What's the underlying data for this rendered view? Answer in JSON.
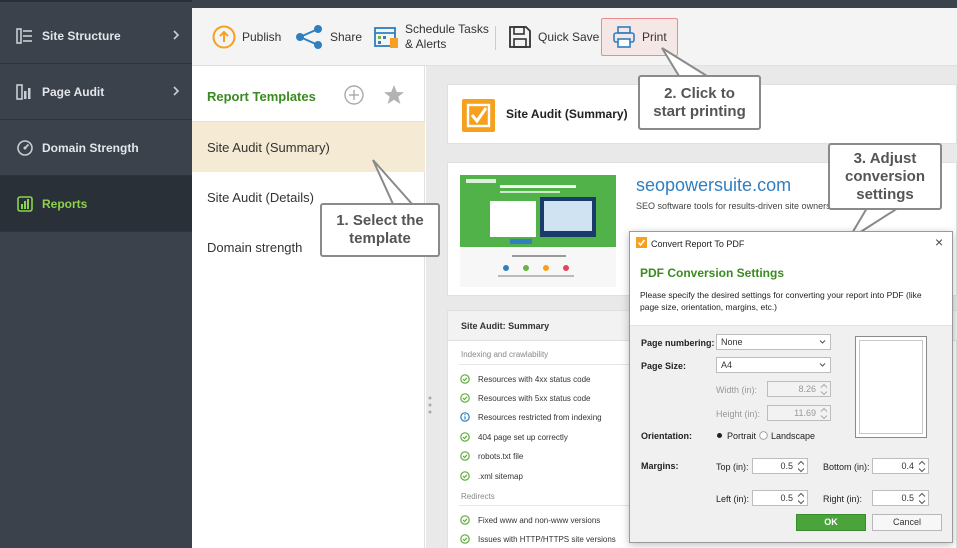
{
  "sidebar": {
    "items": [
      {
        "label": "Site Structure",
        "icon": "site-structure-icon"
      },
      {
        "label": "Page Audit",
        "icon": "page-audit-icon"
      },
      {
        "label": "Domain Strength",
        "icon": "domain-strength-icon"
      },
      {
        "label": "Reports",
        "icon": "reports-icon"
      }
    ],
    "active_color": "#8bd34a",
    "background": "#3b424b"
  },
  "toolbar": {
    "publish": "Publish",
    "share": "Share",
    "schedule_line1": "Schedule Tasks",
    "schedule_line2": "& Alerts",
    "quick_save": "Quick Save",
    "print": "Print"
  },
  "templates": {
    "title": "Report Templates",
    "items": [
      "Site Audit (Summary)",
      "Site Audit (Details)",
      "Domain strength"
    ]
  },
  "report": {
    "header_title": "Site Audit (Summary)",
    "site_url": "seopowersuite.com",
    "site_tagline": "SEO software tools for results-driven site owners",
    "summary_title": "Site Audit: Summary",
    "section_indexing": "Indexing and crawlability",
    "indexing_items": [
      "Resources with 4xx status code",
      "Resources with 5xx status code",
      "Resources restricted from indexing",
      "404 page set up correctly",
      "robots.txt file",
      ".xml sitemap"
    ],
    "section_redirects": "Redirects",
    "redirect_items": [
      "Fixed www and non-www versions",
      "Issues with HTTP/HTTPS site versions"
    ]
  },
  "callouts": {
    "select_line1": "1. Select the",
    "select_line2": "template",
    "print_line1": "2. Click to",
    "print_line2": "start printing",
    "adjust_line1": "3. Adjust",
    "adjust_line2": "conversion",
    "adjust_line3": "settings"
  },
  "dialog": {
    "window_title": "Convert Report To PDF",
    "heading": "PDF Conversion Settings",
    "description_line1": "Please specify the desired settings for converting your report into PDF (like",
    "description_line2": "page size, orientation, margins, etc.)",
    "page_numbering_label": "Page numbering:",
    "page_numbering_value": "None",
    "page_size_label": "Page Size:",
    "page_size_value": "A4",
    "width_label": "Width (in):",
    "width_value": "8.26",
    "height_label": "Height (in):",
    "height_value": "11.69",
    "orientation_label": "Orientation:",
    "portrait_label": "Portrait",
    "landscape_label": "Landscape",
    "margins_label": "Margins:",
    "top_label": "Top (in):",
    "top_value": "0.5",
    "bottom_label": "Bottom (in):",
    "bottom_value": "0.4",
    "left_label": "Left (in):",
    "left_value": "0.5",
    "right_label": "Right (in):",
    "right_value": "0.5",
    "ok_label": "OK",
    "cancel_label": "Cancel",
    "close_glyph": "×"
  },
  "colors": {
    "accent_green": "#3a8b1f",
    "ok_button": "#4aa43b",
    "orange": "#f7a01d",
    "link_blue": "#2f7fc1"
  }
}
